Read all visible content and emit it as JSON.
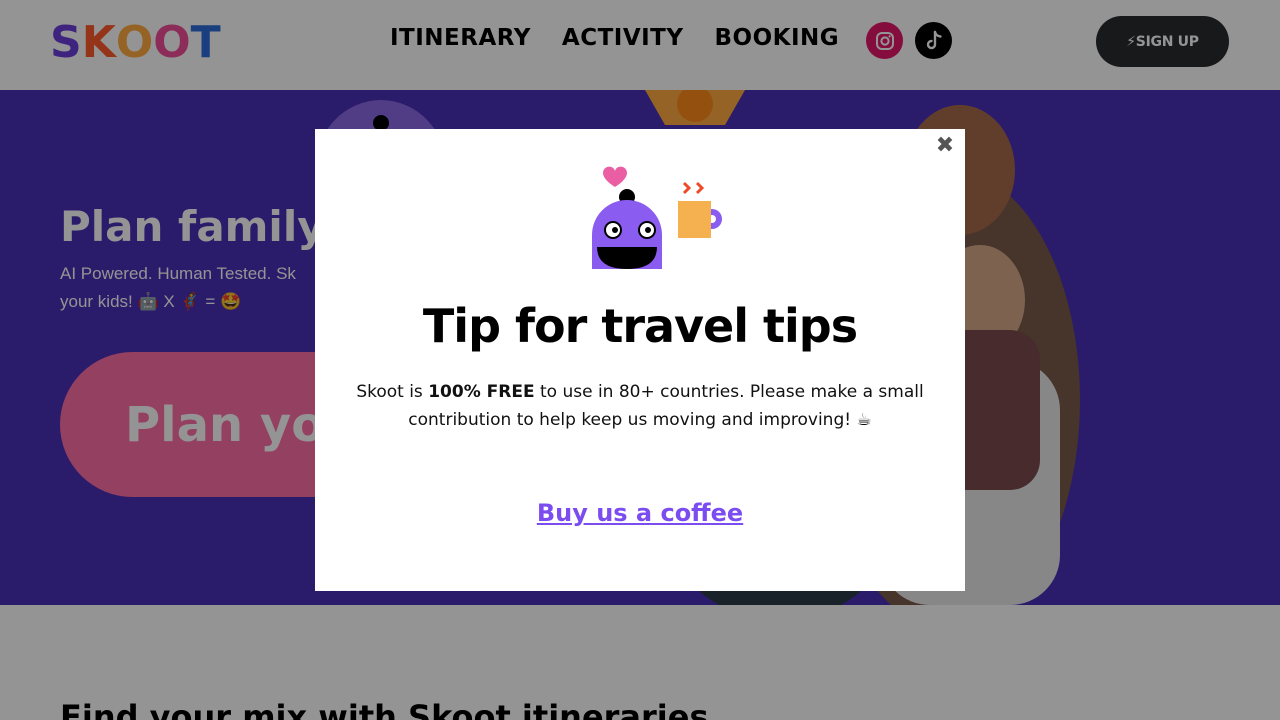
{
  "header": {
    "logo_letters": [
      "S",
      "K",
      "O",
      "O",
      "T"
    ],
    "logo_colors": [
      "#6c3fd9",
      "#ff5a2c",
      "#ffab40",
      "#f24f9a",
      "#2f6bd9"
    ],
    "nav": [
      "ITINERARY",
      "ACTIVITY",
      "BOOKING"
    ],
    "social": [
      {
        "name": "instagram-icon",
        "color": "#e4186b"
      },
      {
        "name": "tiktok-icon",
        "color": "#000000"
      }
    ],
    "signup_label": "⚡SIGN UP"
  },
  "hero": {
    "title": "Plan family i",
    "subtitle_line1": "AI Powered. Human Tested. Sk",
    "subtitle_line2": "your kids! 🤖 X 🦸 = 🤩",
    "cta_label": "Plan you",
    "background": "#4a2fb8",
    "cta_color": "#ff6fa8"
  },
  "section": {
    "title": "Find your mix with Skoot itineraries"
  },
  "modal": {
    "close_label": "✖",
    "title": "Tip for travel tips",
    "body_pre": "Skoot is ",
    "body_bold": "100% FREE",
    "body_post": " to use in 80+ countries. Please make a small contribution to help keep us moving and improving! ☕",
    "link_label": "Buy us a coffee",
    "link_color": "#7b4df0"
  }
}
